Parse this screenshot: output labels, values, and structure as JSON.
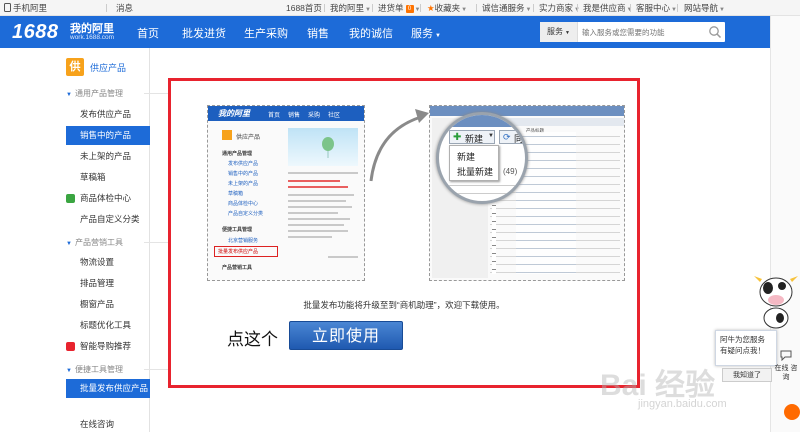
{
  "topbar": {
    "mobile": "手机阿里",
    "messages": "消息",
    "home_1688": "1688首页",
    "my_alibaba": "我的阿里",
    "purchases": "进货单",
    "purchases_count": "0",
    "favorites": "收藏夹",
    "trust_service": "诚信通服务",
    "find_seller": "实力商家",
    "im_supplier": "我是供应商",
    "service_center": "客服中心",
    "site_nav": "网站导航"
  },
  "header": {
    "logo": "1688",
    "title": "我的阿里",
    "url": "work.1688.com",
    "nav": [
      "首页",
      "批发进货",
      "生产采购",
      "销售",
      "我的诚信",
      "服务"
    ],
    "search_scope": "服务",
    "search_placeholder": "输入服务或您需要的功能"
  },
  "sidebar": {
    "header_icon_text": "供",
    "header_label": "供应产品",
    "group1": "通用产品管理",
    "items1": [
      "发布供应产品",
      "销售中的产品",
      "未上架的产品",
      "草稿箱",
      "商品体检中心",
      "产品自定义分类"
    ],
    "group2": "产品营销工具",
    "items2": [
      "物流设置",
      "排品管理",
      "橱窗产品",
      "标题优化工具",
      "智能导购推荐"
    ],
    "group3": "便捷工具管理",
    "items3": [
      "批量发布供应产品"
    ],
    "bottom": "在线咨询"
  },
  "content": {
    "caption": "批量发布功能将升级至到“商机助理”，欢迎下载使用。",
    "cta_text": "点这个",
    "cta_button": "立即使用",
    "shot1": {
      "logo": "我的阿里",
      "nav": [
        "首页",
        "销售",
        "采购",
        "社区"
      ],
      "side_title": "供应产品",
      "group1": "通用产品管理",
      "links": [
        "发布供应产品",
        "销售中的产品",
        "未上架的产品",
        "草稿箱",
        "商品体检中心",
        "产品自定义分类"
      ],
      "group2": "便捷工具管理",
      "link_a": "北京营销服务",
      "link_highlight": "批量发布供应产品",
      "group3": "产品营销工具"
    },
    "shot2": {
      "new_button": "新建",
      "sync_button": "同步",
      "menu_new": "新建",
      "menu_batch": "批量新建",
      "count": "(49)",
      "col_header": "产品标题"
    }
  },
  "floating": {
    "message": "阿牛为您服务 有疑问点我！",
    "button": "我知道了",
    "online": "在线 咨询"
  },
  "watermark": {
    "main": "Bai 经验",
    "sub": "jingyan.baidu.com"
  }
}
